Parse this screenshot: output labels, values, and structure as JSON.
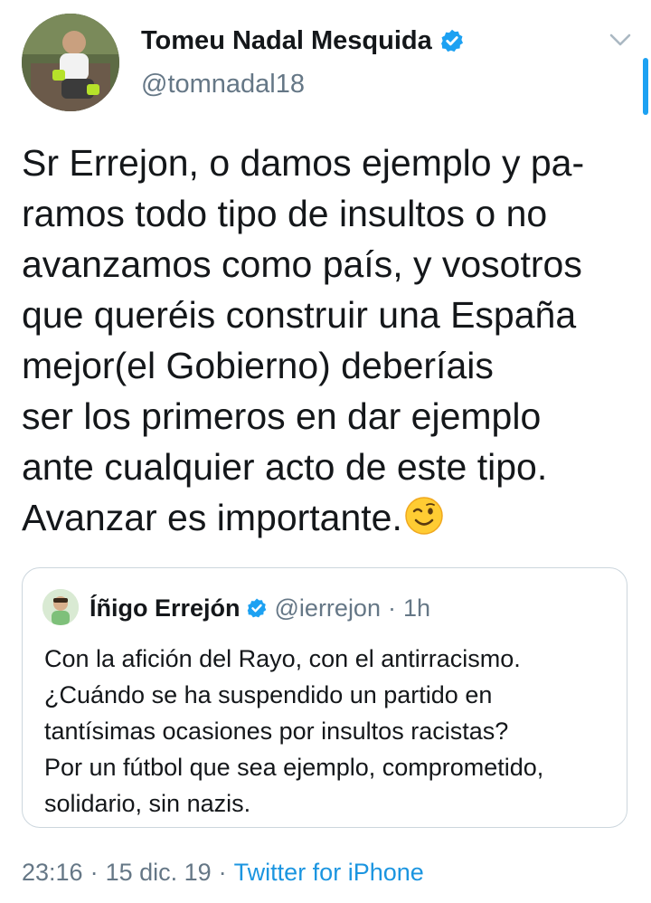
{
  "author": {
    "name": "Tomeu Nadal Mesquida",
    "handle": "@tomnadal18",
    "verified": true
  },
  "tweet": {
    "lines": [
      "Sr Errejon, o damos ejemplo y pa-",
      "ramos todo tipo de insultos o no",
      "avanzamos como país, y vosotros",
      "que queréis construir una España",
      "mejor(el Gobierno) deberíais",
      "ser los primeros en dar ejemplo",
      "ante cualquier acto de este tipo.",
      "Avanzar es importante."
    ],
    "emoji": "winking-face"
  },
  "quoted_tweet": {
    "name": "Íñigo Errejón",
    "handle": "@ierrejon",
    "separator": "·",
    "time": "1h",
    "verified": true,
    "lines": [
      "Con la afición del Rayo, con el antirracismo.",
      "¿Cuándo se ha suspendido un partido en",
      "tantísimas ocasiones por insultos racistas?",
      "Por un fútbol que sea ejemplo, comprometido,",
      "solidario, sin nazis."
    ]
  },
  "meta": {
    "time": "23:16",
    "separator": "·",
    "date": "15 dic. 19",
    "source": "Twitter for iPhone"
  },
  "colors": {
    "link_blue": "#1b95e0",
    "verified_blue": "#1da1f2",
    "secondary_gray": "#657786",
    "border": "#ccd6dd"
  }
}
